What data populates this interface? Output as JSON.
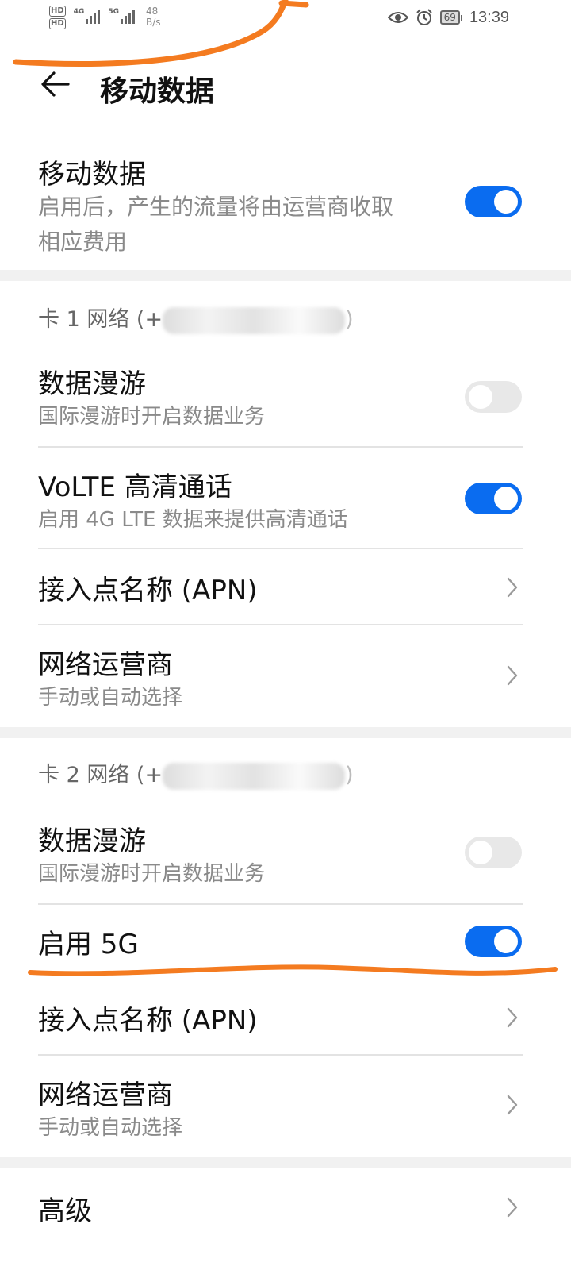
{
  "status_bar": {
    "hd1": "HD",
    "hd2": "HD",
    "net1": "4G",
    "net2": "5G",
    "speed_value": "48",
    "speed_unit": "B/s",
    "battery": "69",
    "time": "13:39",
    "icons": [
      "eye-icon",
      "alarm-icon",
      "battery-icon"
    ]
  },
  "header": {
    "title": "移动数据",
    "back_icon": "back-arrow-icon"
  },
  "mobile_data": {
    "title": "移动数据",
    "subtitle_line1": "启用后，产生的流量将由运营商收取",
    "subtitle_line2": "相应费用",
    "enabled": true
  },
  "sim1": {
    "header": "卡 1 网络 (+",
    "header_suffix": ")",
    "roaming": {
      "title": "数据漫游",
      "subtitle": "国际漫游时开启数据业务",
      "enabled": false
    },
    "volte": {
      "title": "VoLTE 高清通话",
      "subtitle": "启用 4G LTE 数据来提供高清通话",
      "enabled": true
    },
    "apn": {
      "title": "接入点名称 (APN)"
    },
    "carrier": {
      "title": "网络运营商",
      "subtitle": "手动或自动选择"
    }
  },
  "sim2": {
    "header": "卡 2 网络 (+",
    "header_suffix": ")",
    "roaming": {
      "title": "数据漫游",
      "subtitle": "国际漫游时开启数据业务",
      "enabled": false
    },
    "enable_5g": {
      "title": "启用 5G",
      "enabled": true
    },
    "apn": {
      "title": "接入点名称 (APN)"
    },
    "carrier": {
      "title": "网络运营商",
      "subtitle": "手动或自动选择"
    }
  },
  "advanced": {
    "title": "高级"
  },
  "colors": {
    "accent": "#0a6cf0",
    "annotation": "#f47b20"
  }
}
